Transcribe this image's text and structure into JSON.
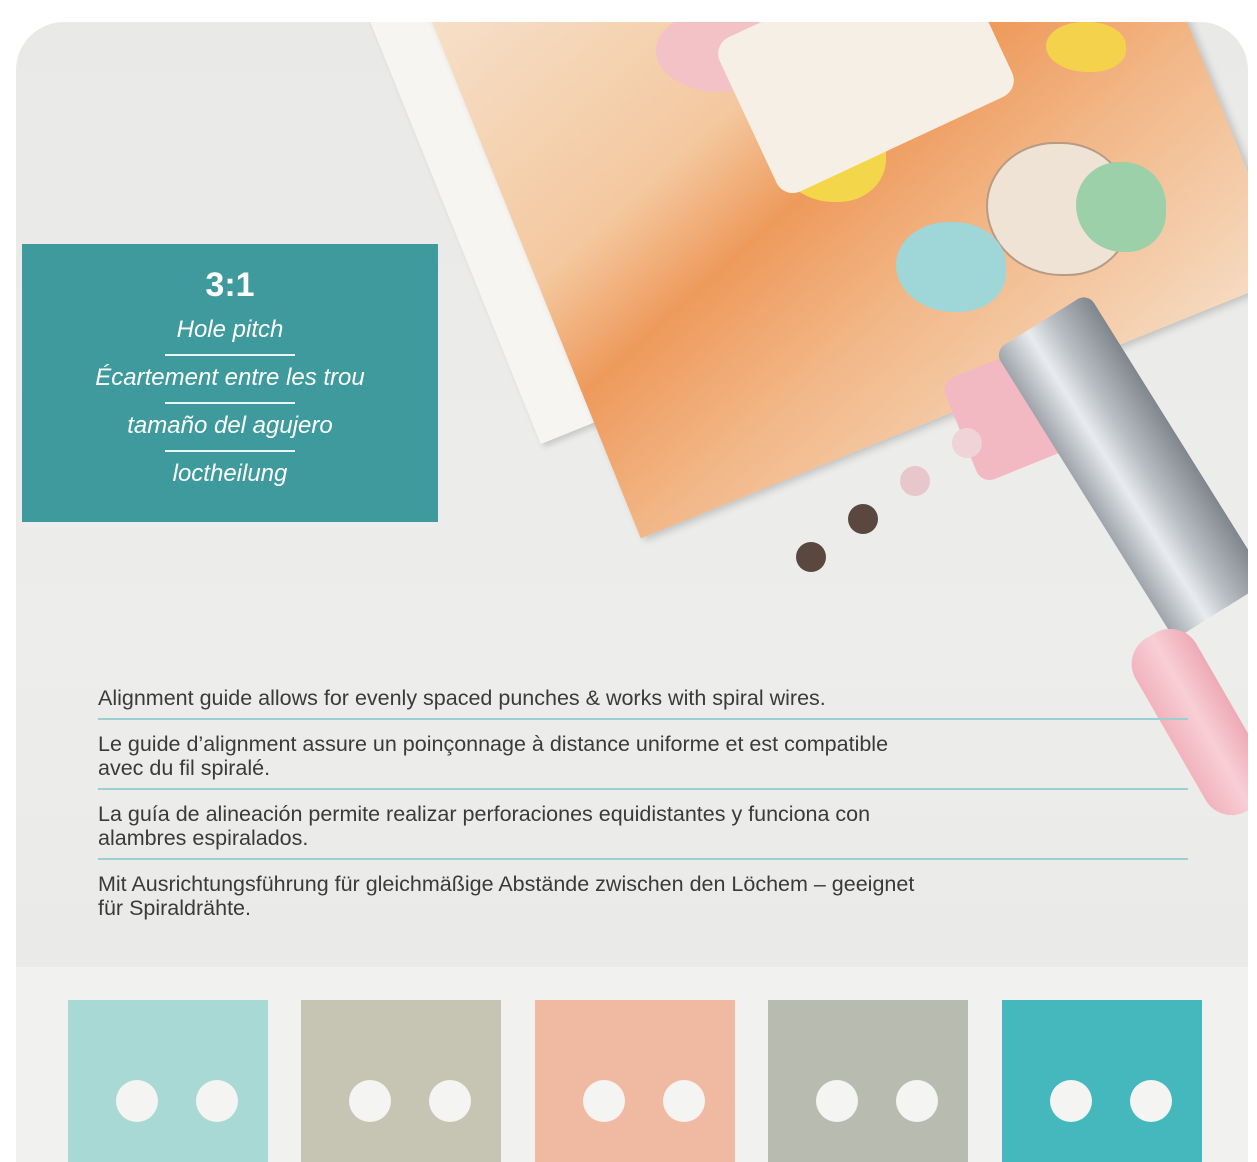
{
  "info_box": {
    "ratio": "3:1",
    "labels": [
      "Hole pitch",
      "Écartement entre les trou",
      "tamaño del agujero",
      "loctheilung"
    ],
    "color": "#3e9a9c"
  },
  "description": [
    "Alignment guide allows for evenly spaced punches & works with spiral wires.",
    "Le guide d’alignment assure un poinçonnage à distance uniforme et est compatible\navec du fil spiralé.",
    "La guía de alineación permite realizar perforaciones equidistantes y funciona con\nalambres espiralados.",
    "Mit Ausrichtungsführung für gleichmäßige Abstände zwischen den Löchem – geeignet\nfür Spiraldrähte."
  ],
  "swatches": [
    {
      "color": "#a9d9d4"
    },
    {
      "color": "#c6c4b3"
    },
    {
      "color": "#f0b9a2"
    },
    {
      "color": "#b8bcb0"
    },
    {
      "color": "#45b8be"
    }
  ],
  "punched_holes": {
    "colors": [
      "#5a4840",
      "#5a4840",
      "#e8c7cc",
      "#efd3d6"
    ]
  }
}
